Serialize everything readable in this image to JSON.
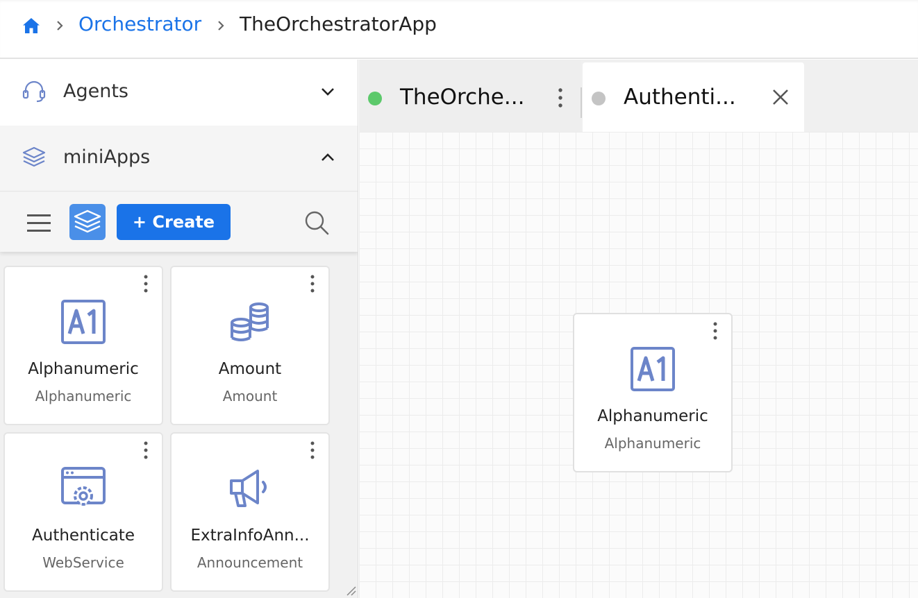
{
  "breadcrumb": {
    "home_icon": "home-icon",
    "items": [
      "Orchestrator",
      "TheOrchestratorApp"
    ]
  },
  "sidebar": {
    "sections": [
      {
        "label": "Agents",
        "icon": "headset-icon",
        "expanded": false
      },
      {
        "label": "miniApps",
        "icon": "layers-icon",
        "expanded": true
      }
    ],
    "toolbar": {
      "create_label": "+ Create",
      "menu_icon": "hamburger-menu-icon",
      "layers_icon": "layers-icon",
      "search_icon": "search-icon"
    },
    "cards": [
      {
        "title": "Alphanumeric",
        "subtitle": "Alphanumeric",
        "icon": "alphanumeric-icon"
      },
      {
        "title": "Amount",
        "subtitle": "Amount",
        "icon": "coins-icon"
      },
      {
        "title": "Authenticate",
        "subtitle": "WebService",
        "icon": "webservice-icon"
      },
      {
        "title": "ExtraInfoAnn...",
        "subtitle": "Announcement",
        "icon": "megaphone-icon"
      }
    ]
  },
  "tabs": [
    {
      "label": "TheOrche...",
      "status": "active",
      "status_color": "#5cc96b"
    },
    {
      "label": "Authenti...",
      "status": "inactive",
      "status_color": "#c4c4c4"
    }
  ],
  "canvas": {
    "nodes": [
      {
        "title": "Alphanumeric",
        "subtitle": "Alphanumeric",
        "icon": "alphanumeric-icon"
      }
    ]
  },
  "colors": {
    "accent": "#1a73e8",
    "icon": "#6c85c9"
  }
}
